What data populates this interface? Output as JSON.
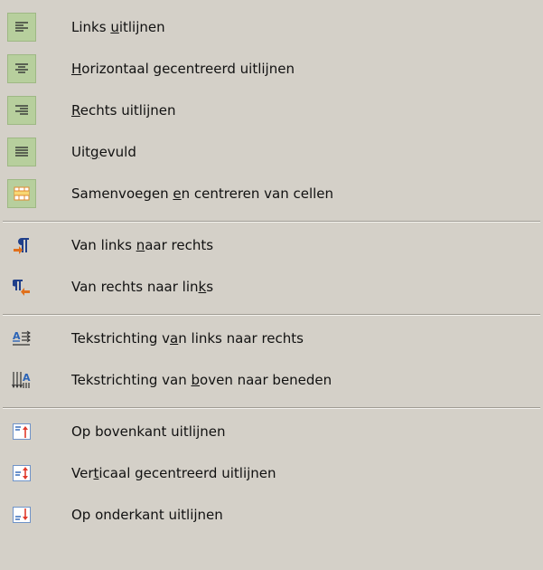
{
  "menu": {
    "groups": [
      {
        "items": [
          {
            "icon": "align-left-icon",
            "checked": true,
            "pre": "Links ",
            "acc": "u",
            "post": "itlijnen"
          },
          {
            "icon": "align-center-icon",
            "checked": true,
            "pre": "",
            "acc": "H",
            "post": "orizontaal gecentreerd uitlijnen"
          },
          {
            "icon": "align-right-icon",
            "checked": true,
            "pre": "",
            "acc": "R",
            "post": "echts uitlijnen"
          },
          {
            "icon": "align-justify-icon",
            "checked": true,
            "pre": "Uit",
            "acc": "g",
            "post": "evuld"
          },
          {
            "icon": "merge-center-cells-icon",
            "checked": true,
            "pre": "Samenvoegen ",
            "acc": "e",
            "post": "n centreren van cellen"
          }
        ]
      },
      {
        "items": [
          {
            "icon": "paragraph-ltr-icon",
            "checked": false,
            "pre": "Van links ",
            "acc": "n",
            "post": "aar rechts"
          },
          {
            "icon": "paragraph-rtl-icon",
            "checked": false,
            "pre": "Van rechts naar lin",
            "acc": "k",
            "post": "s"
          }
        ]
      },
      {
        "items": [
          {
            "icon": "text-direction-horizontal-icon",
            "checked": false,
            "pre": "Tekstrichting v",
            "acc": "a",
            "post": "n links naar rechts"
          },
          {
            "icon": "text-direction-vertical-icon",
            "checked": false,
            "pre": "Tekstrichting van ",
            "acc": "b",
            "post": "oven naar beneden"
          }
        ]
      },
      {
        "items": [
          {
            "icon": "align-top-icon",
            "checked": false,
            "pre": "Op bovenkant uitlijnen",
            "acc": "",
            "post": ""
          },
          {
            "icon": "align-vertical-center-icon",
            "checked": false,
            "pre": "Ver",
            "acc": "t",
            "post": "icaal gecentreerd uitlijnen"
          },
          {
            "icon": "align-bottom-icon",
            "checked": false,
            "pre": "Op onderkant uitlijnen",
            "acc": "",
            "post": ""
          }
        ]
      }
    ]
  }
}
